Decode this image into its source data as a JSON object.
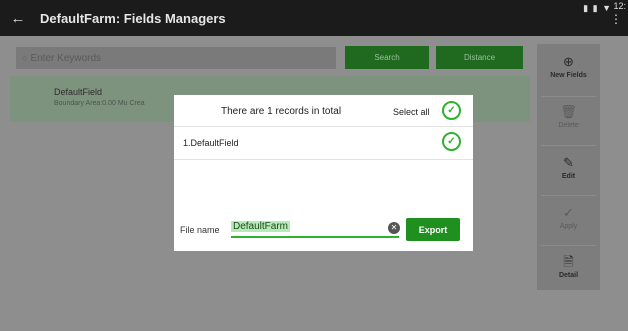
{
  "appbar": {
    "title": "DefaultFarm: Fields Managers",
    "back_icon": "←",
    "status_icons": "▮ ▮ ▼",
    "time": "12:",
    "overflow_icon": "⋮"
  },
  "search": {
    "placeholder": "Enter Keywords",
    "search_label": "Search",
    "distance_label": "Distance"
  },
  "list": {
    "items": [
      {
        "name": "DefaultField",
        "detail": "Boundary Area:0.00 Mu   Crea"
      }
    ]
  },
  "right_panel": {
    "buttons": [
      {
        "icon": "⊕",
        "label": "New Fields"
      },
      {
        "icon": "🗑",
        "label": "Delete"
      },
      {
        "icon": "✎",
        "label": "Edit"
      },
      {
        "icon": "✓",
        "label": "Apply"
      },
      {
        "icon": "🗎",
        "label": "Detail"
      }
    ]
  },
  "dialog": {
    "title": "There are 1 records in total",
    "select_all_label": "Select all",
    "check_icon": "✓",
    "items": [
      {
        "label": "1.DefaultField"
      }
    ],
    "file_name_label": "File name",
    "file_name_value": "DefaultFarm",
    "clear_icon": "✕",
    "export_label": "Export"
  },
  "colors": {
    "accent_green": "#2fb12f",
    "appbar_bg": "#1b1b1b",
    "export_btn": "#1f8f1f"
  }
}
